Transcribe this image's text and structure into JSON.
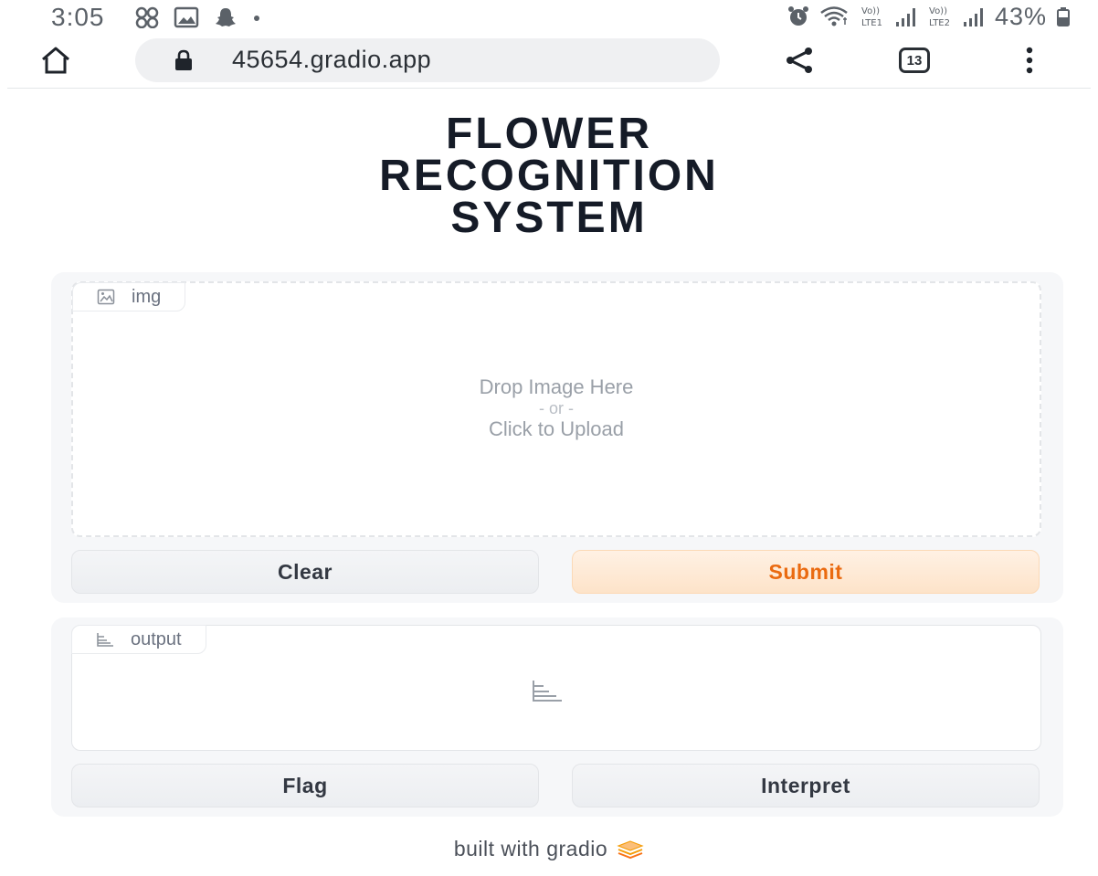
{
  "status_bar": {
    "time": "3:05",
    "battery": "43%",
    "left_icons": [
      "pinwheel-icon",
      "gallery-icon",
      "snapchat-icon",
      "dot-icon"
    ],
    "right_icons": [
      "alarm-icon",
      "wifi-icon",
      "signal-lte1-icon",
      "signal-lte2-icon",
      "battery-icon"
    ]
  },
  "browser": {
    "url": "45654.gradio.app",
    "tab_count": "13"
  },
  "page": {
    "title": "FLOWER\nRECOGNITION\nSYSTEM"
  },
  "input": {
    "label": "img",
    "drop_text": "Drop Image Here",
    "or_text": "- or -",
    "click_text": "Click to Upload",
    "clear_label": "Clear",
    "submit_label": "Submit"
  },
  "output": {
    "label": "output",
    "flag_label": "Flag",
    "interpret_label": "Interpret"
  },
  "footer": {
    "text": "built with gradio"
  },
  "colors": {
    "accent": "#ea6a10",
    "submit_bg": "#fde3c9",
    "title": "#151b27"
  }
}
